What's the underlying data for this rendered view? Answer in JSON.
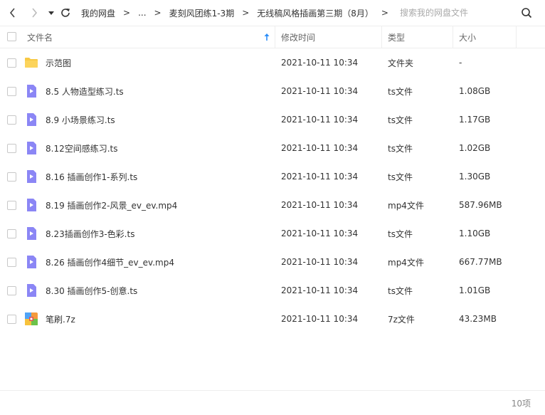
{
  "toolbar": {
    "back_icon": "chevron-left-icon",
    "forward_icon": "chevron-right-icon",
    "history_icon": "caret-down-icon",
    "refresh_icon": "refresh-icon"
  },
  "breadcrumb": {
    "items": [
      "我的网盘",
      "...",
      "麦刻风团练1-3期",
      "无线稿风格插画第三期（8月）"
    ],
    "separator": ">"
  },
  "search": {
    "placeholder": "搜索我的网盘文件",
    "icon": "search-icon"
  },
  "columns": {
    "name": "文件名",
    "modified": "修改时间",
    "type": "类型",
    "size": "大小",
    "sort_icon": "sort-up-arrow-icon"
  },
  "colors": {
    "accent": "#2c8ef8",
    "folder": "#f8c944",
    "video": "#8b86f5",
    "border": "#eeeeee"
  },
  "files": [
    {
      "icon": "folder-icon",
      "name": "示范图",
      "modified": "2021-10-11 10:34",
      "type": "文件夹",
      "size": "-"
    },
    {
      "icon": "video-file-icon",
      "name": "8.5 人物造型练习.ts",
      "modified": "2021-10-11 10:34",
      "type": "ts文件",
      "size": "1.08GB"
    },
    {
      "icon": "video-file-icon",
      "name": "8.9 小场景练习.ts",
      "modified": "2021-10-11 10:34",
      "type": "ts文件",
      "size": "1.17GB"
    },
    {
      "icon": "video-file-icon",
      "name": "8.12空间感练习.ts",
      "modified": "2021-10-11 10:34",
      "type": "ts文件",
      "size": "1.02GB"
    },
    {
      "icon": "video-file-icon",
      "name": "8.16 插画创作1-系列.ts",
      "modified": "2021-10-11 10:34",
      "type": "ts文件",
      "size": "1.30GB"
    },
    {
      "icon": "video-file-icon",
      "name": "8.19 插画创作2-风景_ev_ev.mp4",
      "modified": "2021-10-11 10:34",
      "type": "mp4文件",
      "size": "587.96MB"
    },
    {
      "icon": "video-file-icon",
      "name": "8.23插画创作3-色彩.ts",
      "modified": "2021-10-11 10:34",
      "type": "ts文件",
      "size": "1.10GB"
    },
    {
      "icon": "video-file-icon",
      "name": "8.26 插画创作4细节_ev_ev.mp4",
      "modified": "2021-10-11 10:34",
      "type": "mp4文件",
      "size": "667.77MB"
    },
    {
      "icon": "video-file-icon",
      "name": "8.30 插画创作5-创意.ts",
      "modified": "2021-10-11 10:34",
      "type": "ts文件",
      "size": "1.01GB"
    },
    {
      "icon": "archive-file-icon",
      "name": "笔刷.7z",
      "modified": "2021-10-11 10:34",
      "type": "7z文件",
      "size": "43.23MB"
    }
  ],
  "footer": {
    "count": "10项"
  }
}
